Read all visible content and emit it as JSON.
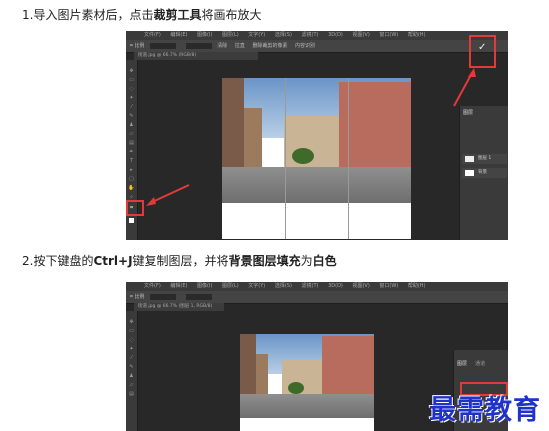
{
  "step1": {
    "prefix": "1.导入图片素材后，点击",
    "bold1": "裁剪工具",
    "suffix": "将画布放大"
  },
  "step2": {
    "prefix": "2.按下键盘的",
    "bold1": "Ctrl+J",
    "middle": "键复制图层，并将",
    "bold2": "背景图层填充",
    "middle2": "为",
    "bold3": "白色"
  },
  "screenshot1": {
    "menu_items": [
      "文件(F)",
      "编辑(E)",
      "图像(I)",
      "图层(L)",
      "文字(Y)",
      "选择(S)",
      "滤镜(T)",
      "3D(D)",
      "视图(V)",
      "窗口(W)",
      "帮助(H)"
    ],
    "options_label": "比例",
    "options_clear": "清除",
    "options_straighten": "拉直",
    "options_delete": "删除裁剪的像素",
    "options_content": "内容识别",
    "tab_label": "街道.jpg @ 66.7% (RGB/8)",
    "layers_tab": "图层",
    "layer1_name": "图层 1",
    "layer2_name": "背景",
    "commit_glyph": "✓"
  },
  "screenshot2": {
    "menu_items": [
      "文件(F)",
      "编辑(E)",
      "图像(I)",
      "图层(L)",
      "文字(Y)",
      "选择(S)",
      "滤镜(T)",
      "3D(D)",
      "视图(V)",
      "窗口(W)",
      "帮助(H)"
    ],
    "options_label": "比例",
    "tab_label": "街道.jpg @ 66.7% (图层 1, RGB/8)",
    "layers_tab": "图层",
    "channels_tab": "通道"
  },
  "watermark": "最需教育",
  "colors": {
    "highlight": "#e23a3a",
    "watermark": "#2033c9",
    "ps_background": "#282828"
  }
}
